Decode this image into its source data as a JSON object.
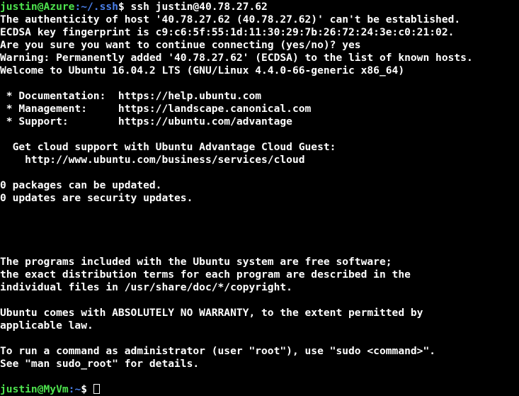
{
  "terminal": {
    "title": "justin@MyVm: ~",
    "background_color": "#000000",
    "foreground_color": "#ffffff",
    "prompt_user_color": "#4ee44e",
    "prompt_path_color": "#4a7fe8",
    "cursor_style": "hollow-block",
    "columns": 75,
    "rows": 30
  },
  "prompt_first": {
    "userhost": "justin@Azure",
    "colon": ":",
    "path": "~/.ssh",
    "dollar": "$ ",
    "command": "ssh justin@40.78.27.62"
  },
  "prompt_last": {
    "userhost": "justin@MyVm",
    "colon": ":",
    "path": "~",
    "dollar": "$ ",
    "command": ""
  },
  "output_lines": [
    "The authenticity of host '40.78.27.62 (40.78.27.62)' can't be established.",
    "ECDSA key fingerprint is c9:c6:5f:55:1d:11:30:29:7b:26:72:24:3e:c0:21:02.",
    "Are you sure you want to continue connecting (yes/no)? yes",
    "Warning: Permanently added '40.78.27.62' (ECDSA) to the list of known hosts.",
    "Welcome to Ubuntu 16.04.2 LTS (GNU/Linux 4.4.0-66-generic x86_64)",
    "",
    " * Documentation:  https://help.ubuntu.com",
    " * Management:     https://landscape.canonical.com",
    " * Support:        https://ubuntu.com/advantage",
    "",
    "  Get cloud support with Ubuntu Advantage Cloud Guest:",
    "    http://www.ubuntu.com/business/services/cloud",
    "",
    "0 packages can be updated.",
    "0 updates are security updates.",
    "",
    "",
    "",
    "",
    "The programs included with the Ubuntu system are free software;",
    "the exact distribution terms for each program are described in the",
    "individual files in /usr/share/doc/*/copyright.",
    "",
    "Ubuntu comes with ABSOLUTELY NO WARRANTY, to the extent permitted by",
    "applicable law.",
    "",
    "To run a command as administrator (user \"root\"), use \"sudo <command>\".",
    "See \"man sudo_root\" for details.",
    ""
  ]
}
